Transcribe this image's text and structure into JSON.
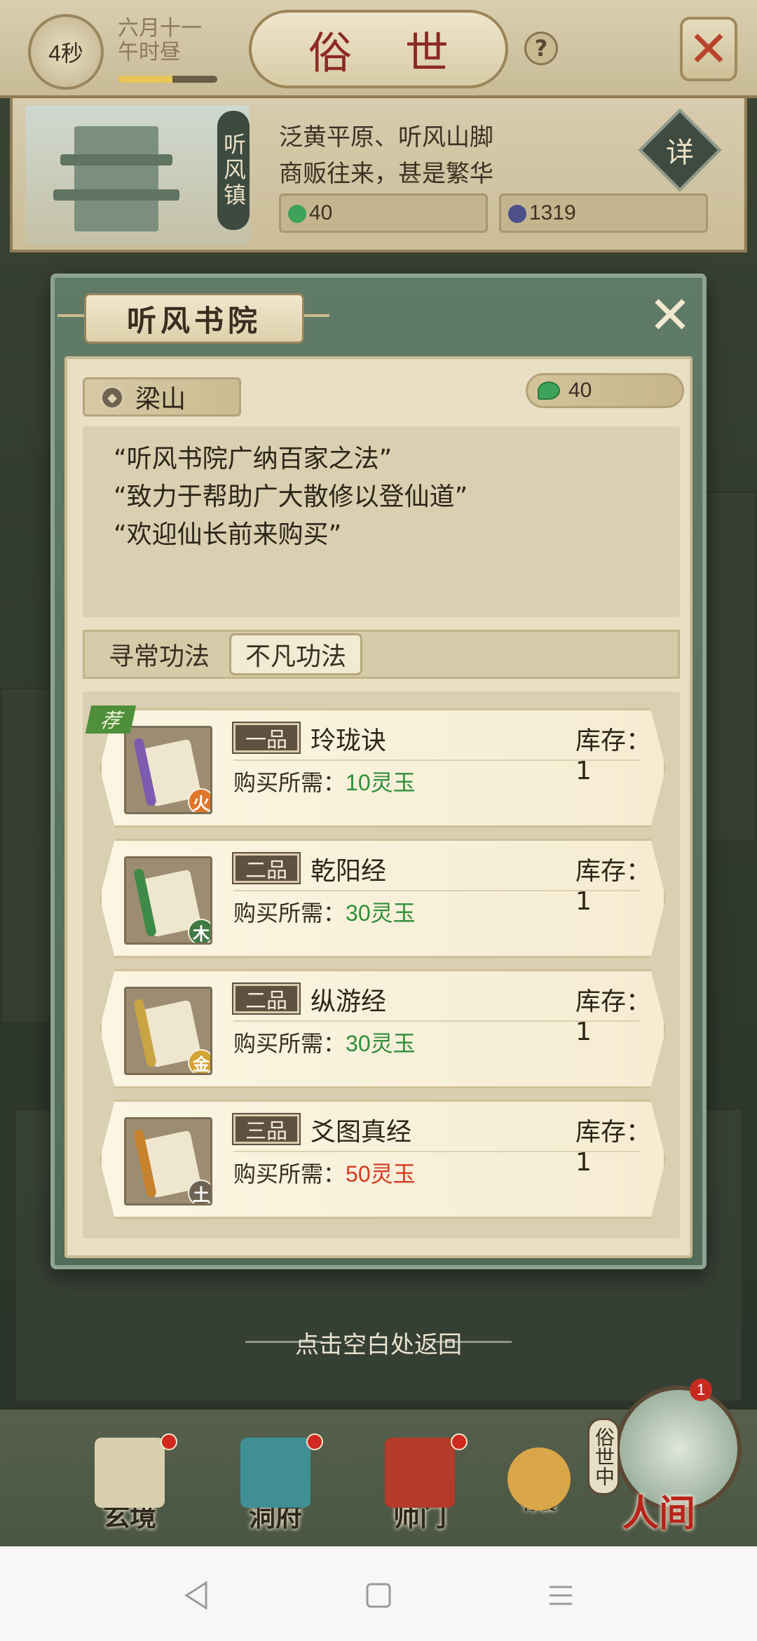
{
  "header": {
    "timer": "4秒",
    "date_line1": "六月十一",
    "date_line2": "午时昼",
    "time_progress": 0.55,
    "title": "俗 世",
    "help": "?",
    "close_icon": "crossed-swords-icon"
  },
  "location": {
    "banner": "听风镇",
    "desc_line1": "泛黄平原、听风山脚",
    "desc_line2": "商贩往来，甚是繁华",
    "detail_button": "详",
    "jade": "40",
    "spirit_stone": "1319"
  },
  "modal": {
    "title": "听风书院",
    "close_icon": "close-icon",
    "npc_name": "梁山",
    "jade_balance": "40",
    "quotes": [
      "“听风书院广纳百家之法”",
      "“致力于帮助广大散修以登仙道”",
      "“欢迎仙长前来购买”"
    ],
    "tabs": [
      {
        "label": "寻常功法",
        "active": false
      },
      {
        "label": "不凡功法",
        "active": true
      }
    ],
    "price_prefix": "购买所需：",
    "stock_prefix": "库存：",
    "recommend_label": "荐",
    "items": [
      {
        "grade": "一品",
        "name": "玲珑诀",
        "stock": "1",
        "price": "10灵玉",
        "price_color": "#2f8f3a",
        "element": "火",
        "element_color": "#e0762a",
        "rod_color": "#7c5bb0",
        "recommended": true
      },
      {
        "grade": "二品",
        "name": "乾阳经",
        "stock": "1",
        "price": "30灵玉",
        "price_color": "#2f8f3a",
        "element": "木",
        "element_color": "#3f7a45",
        "rod_color": "#3e8a48",
        "recommended": false
      },
      {
        "grade": "二品",
        "name": "纵游经",
        "stock": "1",
        "price": "30灵玉",
        "price_color": "#2f8f3a",
        "element": "金",
        "element_color": "#d4a533",
        "rod_color": "#c9a443",
        "recommended": false
      },
      {
        "grade": "三品",
        "name": "爻图真经",
        "stock": "1",
        "price": "50灵玉",
        "price_color": "#d63a22",
        "element": "土",
        "element_color": "#6e6353",
        "rod_color": "#c7822e",
        "recommended": false
      }
    ]
  },
  "hint": "点击空白处返回",
  "nav": {
    "items": [
      {
        "label": "玄境",
        "icon": "scroll-map-icon",
        "color": "#d8cfae",
        "dot": true
      },
      {
        "label": "洞府",
        "icon": "pavilion-icon",
        "color": "#3f8f95",
        "dot": true
      },
      {
        "label": "师门",
        "icon": "banner-flag-icon",
        "color": "#b43a2a",
        "dot": true
      },
      {
        "label": "行囊",
        "icon": "pouch-icon",
        "color": "#d9a64a",
        "dot": false
      }
    ],
    "world_label": "人间",
    "world_side": "俗世中",
    "world_badge": "1"
  },
  "system_nav": {
    "back_icon": "back-triangle-icon",
    "home_icon": "home-square-icon",
    "menu_icon": "menu-lines-icon"
  }
}
